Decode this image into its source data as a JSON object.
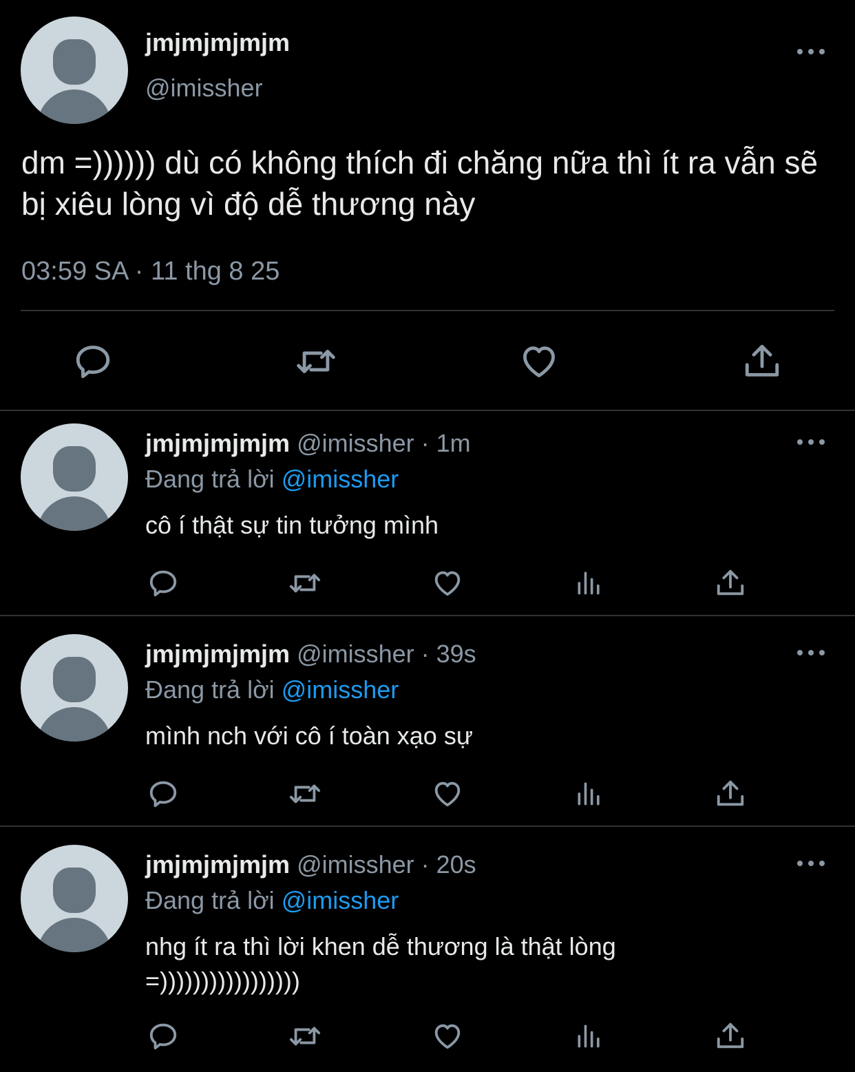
{
  "main_tweet": {
    "display_name": "jmjmjmjmjm",
    "handle": "@imissher",
    "text": "dm =)))))) dù có không thích đi chăng nữa thì ít ra vẫn sẽ bị xiêu lòng vì độ dễ thương này",
    "timestamp": "03:59 SA · 11 thg 8 25"
  },
  "replies": [
    {
      "display_name": "jmjmjmjmjm",
      "handle_time": "@imissher · 1m",
      "replying_prefix": "Đang trả lời",
      "replying_to": "@imissher",
      "text": "cô í thật sự tin tưởng mình"
    },
    {
      "display_name": "jmjmjmjmjm",
      "handle_time": "@imissher · 39s",
      "replying_prefix": "Đang trả lời",
      "replying_to": "@imissher",
      "text": "mình nch với cô í toàn xạo sự"
    },
    {
      "display_name": "jmjmjmjmjm",
      "handle_time": "@imissher · 20s",
      "replying_prefix": "Đang trả lời",
      "replying_to": "@imissher",
      "text": "nhg ít ra thì lời khen dễ thương là thật lòng =)))))))))))))))))"
    }
  ],
  "colors": {
    "background": "#000000",
    "text": "#e7e9ea",
    "muted": "#8b98a5",
    "link": "#1d9bf0",
    "divider": "#2f3336",
    "avatar_bg": "#ccd6dd",
    "avatar_fg": "#66757f"
  },
  "icons": [
    "more-icon",
    "reply-icon",
    "retweet-icon",
    "like-icon",
    "views-icon",
    "share-icon"
  ]
}
